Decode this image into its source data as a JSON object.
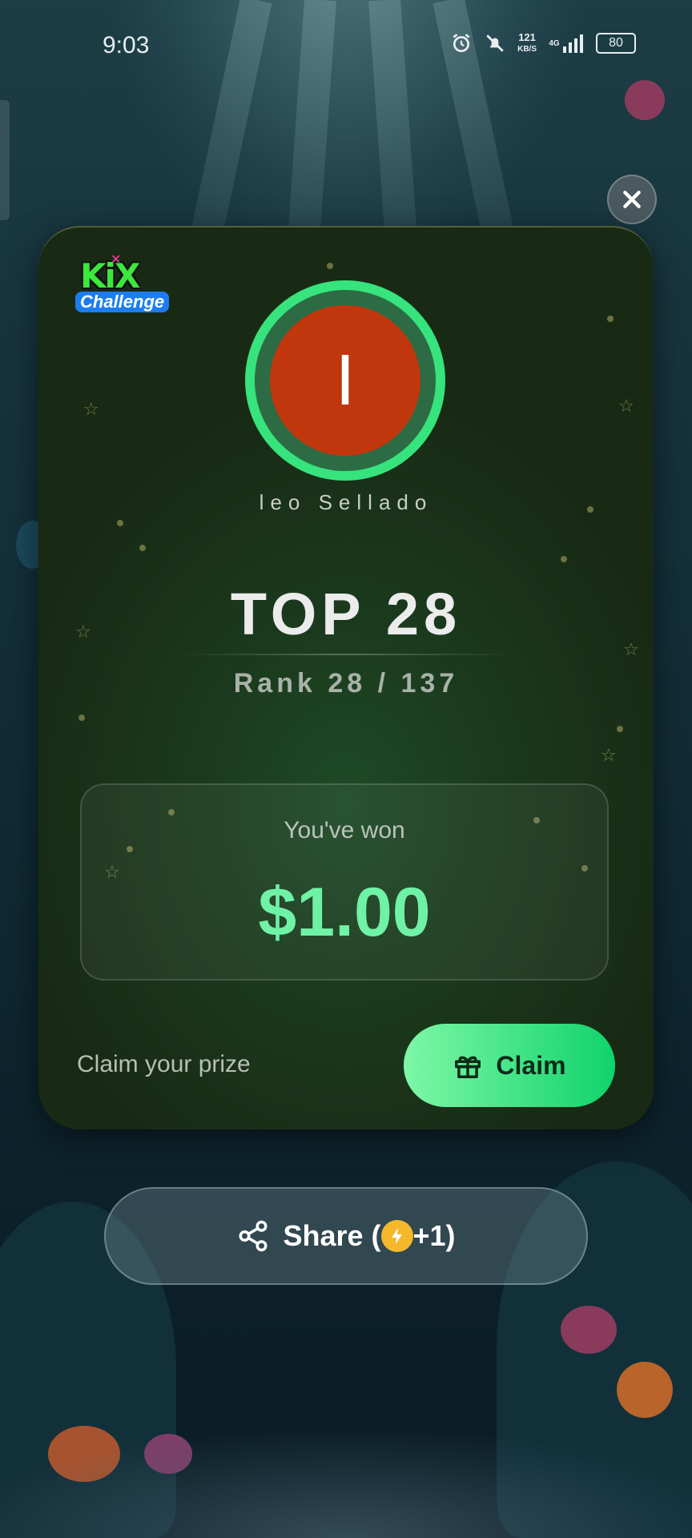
{
  "status_bar": {
    "time": "9:03",
    "speed_value": "121",
    "speed_unit": "KB/S",
    "network": "4G",
    "battery": "80"
  },
  "card": {
    "logo_text": "KiX",
    "logo_subtext": "Challenge",
    "avatar_initial": "I",
    "username": "leo Sellado",
    "title": "TOP 28",
    "rank": "Rank 28 / 137",
    "won_label": "You've won",
    "won_amount": "$1.00",
    "claim_prompt": "Claim your prize",
    "claim_label": "Claim"
  },
  "share": {
    "label_prefix": "Share (",
    "label_suffix": "+1)"
  },
  "colors": {
    "accent_green": "#36e37c",
    "avatar_bg": "#c0370e",
    "card_bg": "#1b3a1d"
  },
  "icons": [
    "close-icon",
    "gift-icon",
    "share-icon",
    "lightning-icon",
    "alarm-icon",
    "mute-icon",
    "signal-icon",
    "battery-icon"
  ]
}
